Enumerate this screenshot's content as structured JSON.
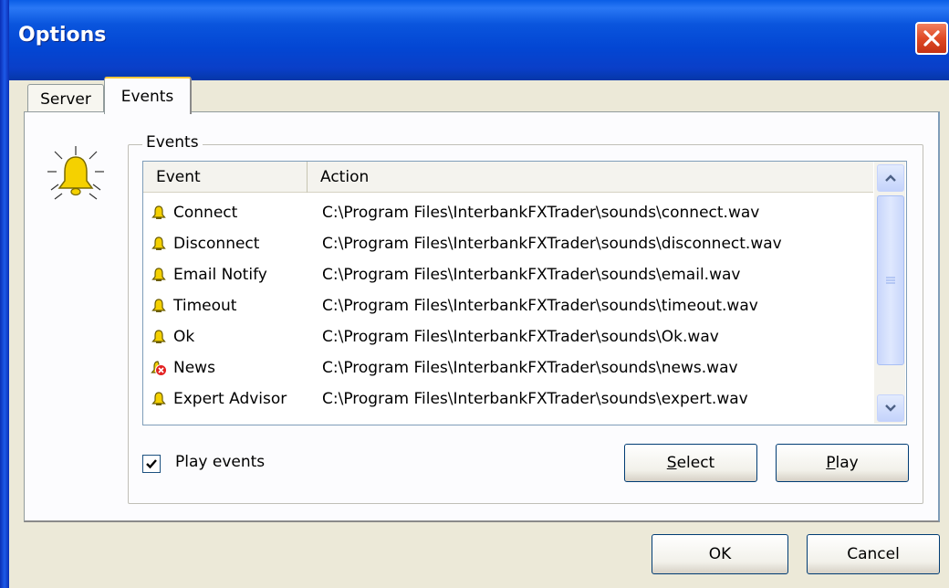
{
  "window": {
    "title": "Options"
  },
  "tabs": [
    {
      "label": "Server",
      "selected": false
    },
    {
      "label": "Events",
      "selected": true
    }
  ],
  "group": {
    "label": "Events"
  },
  "list": {
    "columns": [
      "Event",
      "Action"
    ],
    "rows": [
      {
        "event": "Connect",
        "action": "C:\\Program Files\\InterbankFXTrader\\sounds\\connect.wav",
        "icon": "bell-icon"
      },
      {
        "event": "Disconnect",
        "action": "C:\\Program Files\\InterbankFXTrader\\sounds\\disconnect.wav",
        "icon": "bell-icon"
      },
      {
        "event": "Email Notify",
        "action": "C:\\Program Files\\InterbankFXTrader\\sounds\\email.wav",
        "icon": "bell-icon"
      },
      {
        "event": "Timeout",
        "action": "C:\\Program Files\\InterbankFXTrader\\sounds\\timeout.wav",
        "icon": "bell-icon"
      },
      {
        "event": "Ok",
        "action": "C:\\Program Files\\InterbankFXTrader\\sounds\\Ok.wav",
        "icon": "bell-icon"
      },
      {
        "event": "News",
        "action": "C:\\Program Files\\InterbankFXTrader\\sounds\\news.wav",
        "icon": "bell-disabled-icon"
      },
      {
        "event": "Expert Advisor",
        "action": "C:\\Program Files\\InterbankFXTrader\\sounds\\expert.wav",
        "icon": "bell-icon"
      }
    ]
  },
  "checkbox": {
    "label": "Play events",
    "checked": true
  },
  "buttons": {
    "select": {
      "mnemonic": "S",
      "rest": "elect"
    },
    "play": {
      "mnemonic": "P",
      "rest": "lay"
    },
    "ok": "OK",
    "cancel": "Cancel"
  },
  "colors": {
    "titlebar": "#0a55dd",
    "face": "#ece9d8",
    "close": "#e04a25",
    "bell": "#f5d100",
    "error": "#e32222"
  }
}
